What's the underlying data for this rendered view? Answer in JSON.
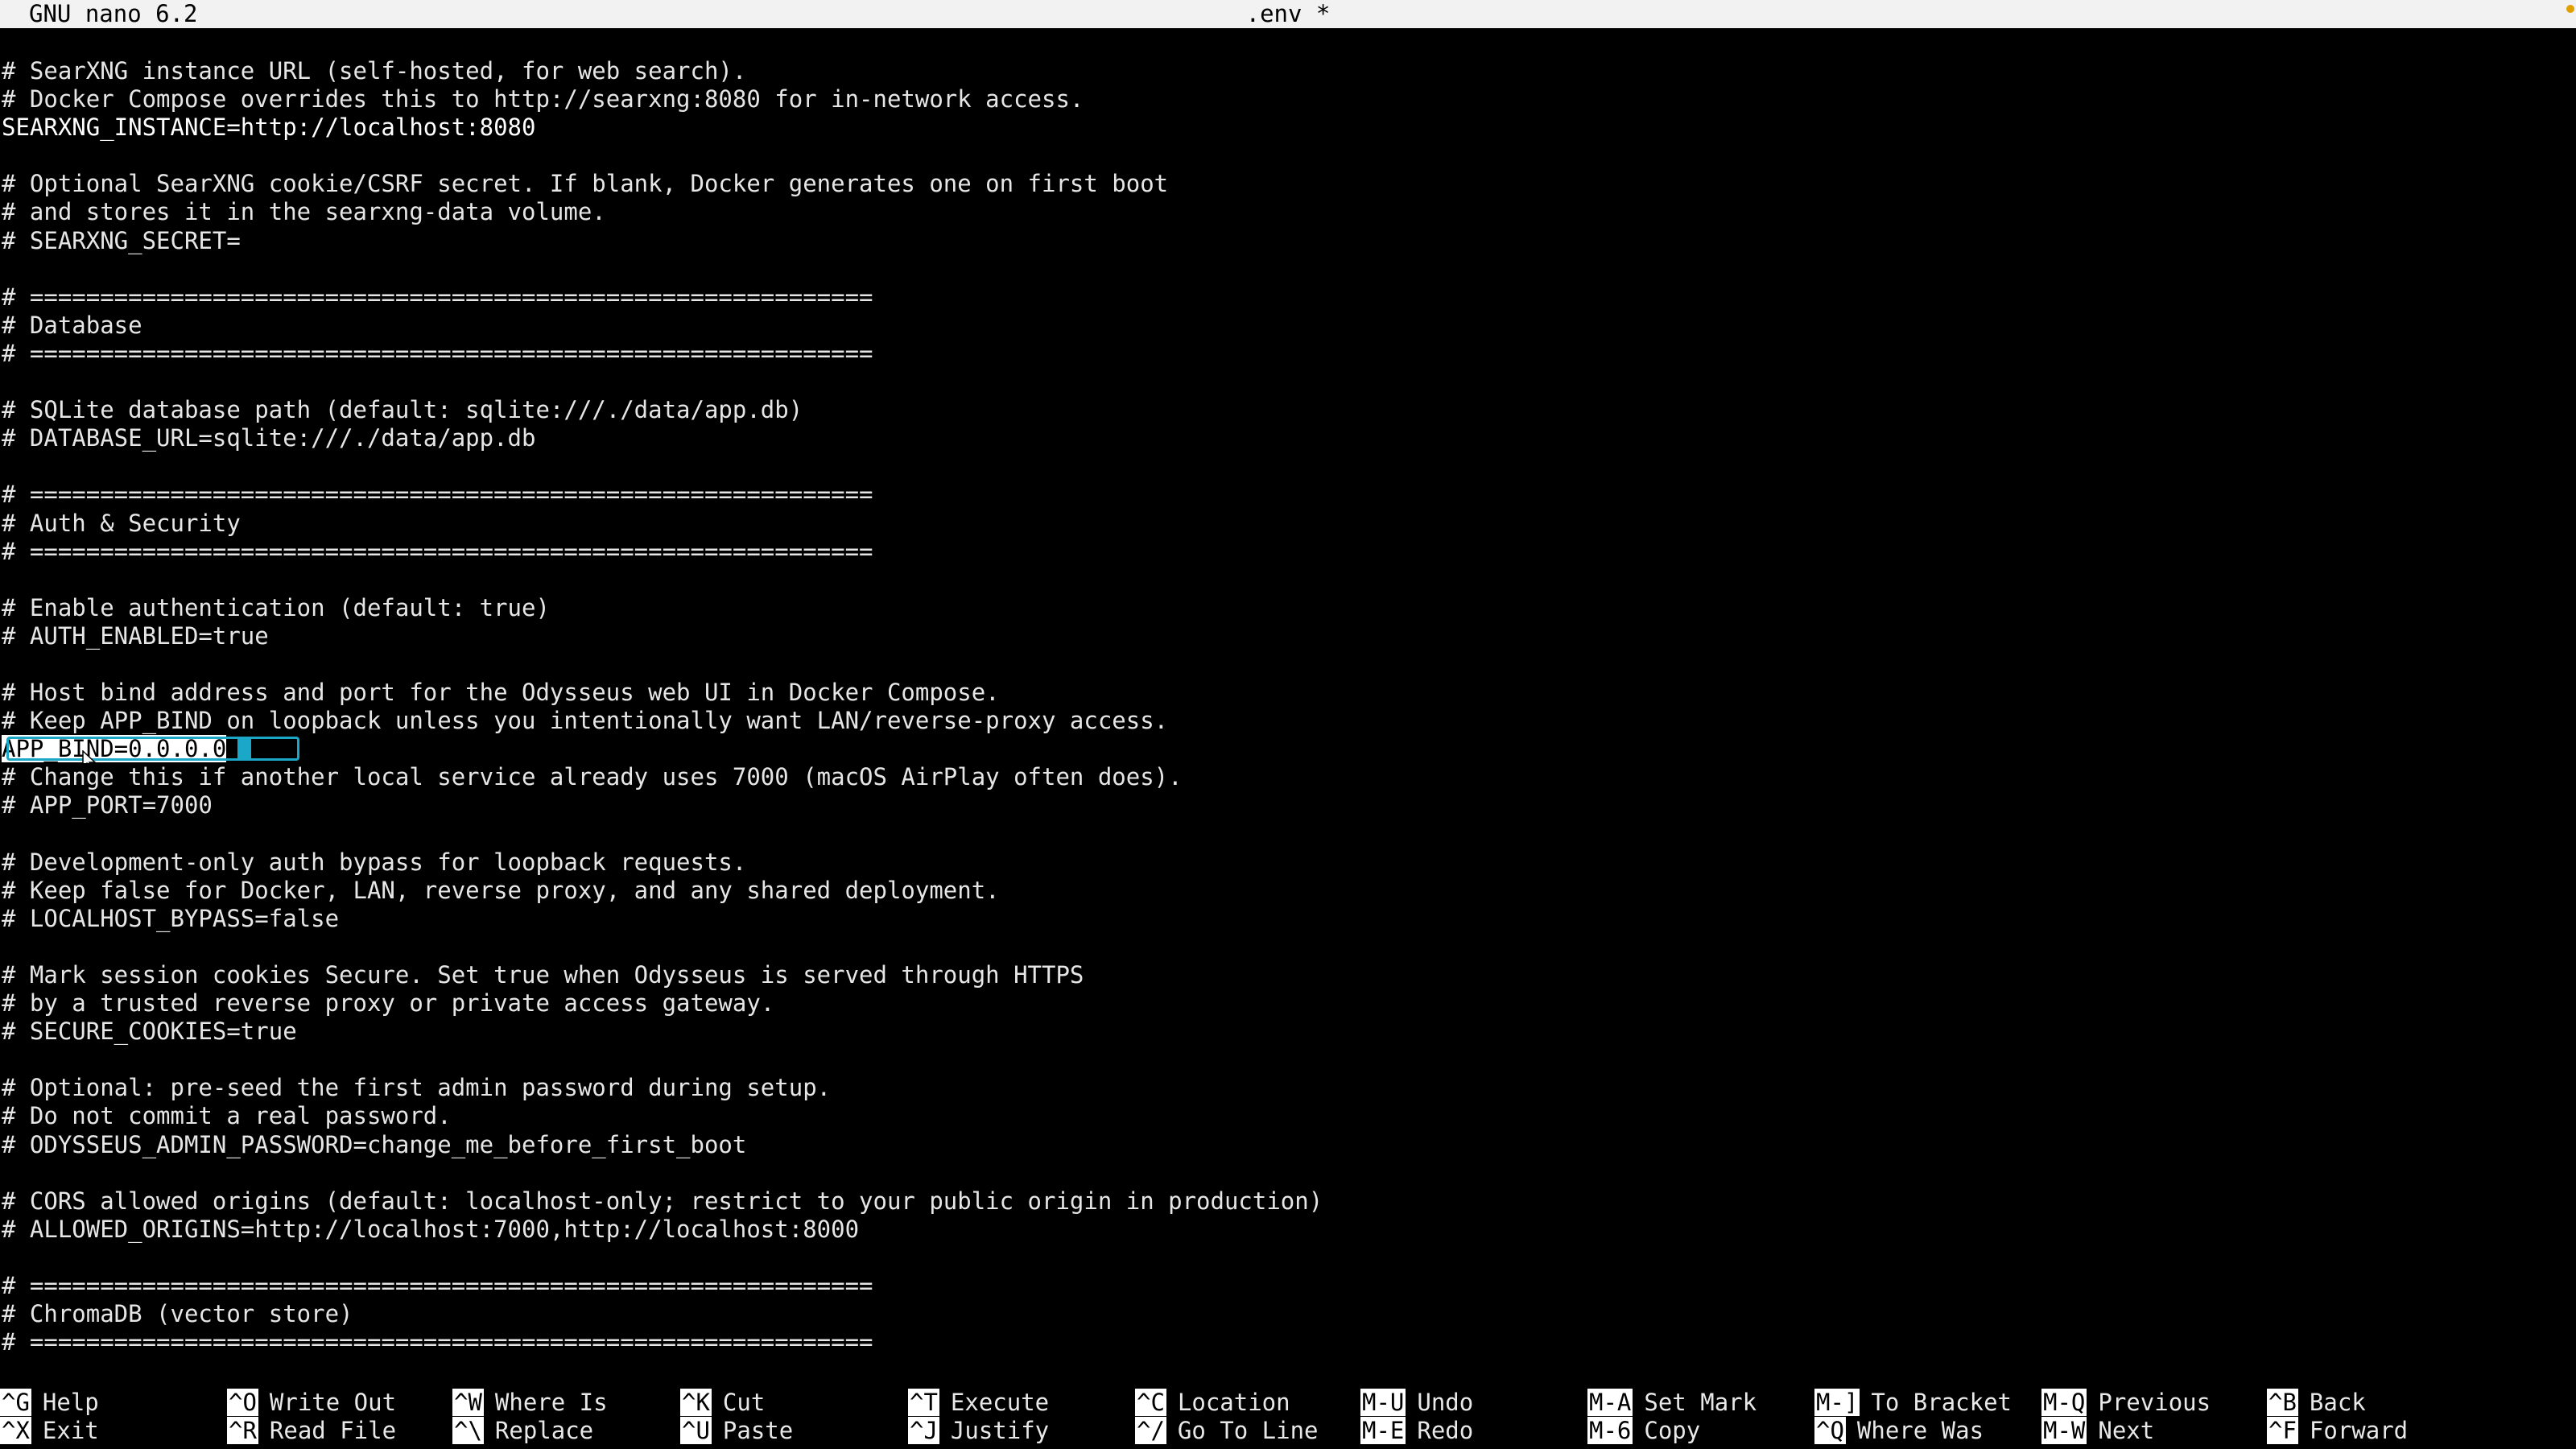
{
  "titlebar": {
    "app": "GNU nano 6.2",
    "file": ".env *"
  },
  "editor": {
    "lines": [
      "# SearXNG instance URL (self-hosted, for web search).",
      "# Docker Compose overrides this to http://searxng:8080 for in-network access.",
      "SEARXNG_INSTANCE=http://localhost:8080",
      "",
      "# Optional SearXNG cookie/CSRF secret. If blank, Docker generates one on first boot",
      "# and stores it in the searxng-data volume.",
      "# SEARXNG_SECRET=",
      "",
      "# ============================================================",
      "# Database",
      "# ============================================================",
      "",
      "# SQLite database path (default: sqlite:///./data/app.db)",
      "# DATABASE_URL=sqlite:///./data/app.db",
      "",
      "# ============================================================",
      "# Auth & Security",
      "# ============================================================",
      "",
      "# Enable authentication (default: true)",
      "# AUTH_ENABLED=true",
      "",
      "# Host bind address and port for the Odysseus web UI in Docker Compose.",
      "# Keep APP_BIND on loopback unless you intentionally want LAN/reverse-proxy access.",
      "APP_BIND=0.0.0.0",
      "# Change this if another local service already uses 7000 (macOS AirPlay often does).",
      "# APP_PORT=7000",
      "",
      "# Development-only auth bypass for loopback requests.",
      "# Keep false for Docker, LAN, reverse proxy, and any shared deployment.",
      "# LOCALHOST_BYPASS=false",
      "",
      "# Mark session cookies Secure. Set true when Odysseus is served through HTTPS",
      "# by a trusted reverse proxy or private access gateway.",
      "# SECURE_COOKIES=true",
      "",
      "# Optional: pre-seed the first admin password during setup.",
      "# Do not commit a real password.",
      "# ODYSSEUS_ADMIN_PASSWORD=change_me_before_first_boot",
      "",
      "# CORS allowed origins (default: localhost-only; restrict to your public origin in production)",
      "# ALLOWED_ORIGINS=http://localhost:7000,http://localhost:8000",
      "",
      "# ============================================================",
      "# ChromaDB (vector store)",
      "# ============================================================"
    ],
    "current_line_index": 24
  },
  "shortcuts": [
    {
      "key": "^G",
      "label": "Help"
    },
    {
      "key": "^X",
      "label": "Exit"
    },
    {
      "key": "^O",
      "label": "Write Out"
    },
    {
      "key": "^R",
      "label": "Read File"
    },
    {
      "key": "^W",
      "label": "Where Is"
    },
    {
      "key": "^\\",
      "label": "Replace"
    },
    {
      "key": "^K",
      "label": "Cut"
    },
    {
      "key": "^U",
      "label": "Paste"
    },
    {
      "key": "^T",
      "label": "Execute"
    },
    {
      "key": "^J",
      "label": "Justify"
    },
    {
      "key": "^C",
      "label": "Location"
    },
    {
      "key": "^/",
      "label": "Go To Line"
    },
    {
      "key": "M-U",
      "label": "Undo"
    },
    {
      "key": "M-E",
      "label": "Redo"
    },
    {
      "key": "M-A",
      "label": "Set Mark"
    },
    {
      "key": "M-6",
      "label": "Copy"
    },
    {
      "key": "M-]",
      "label": "To Bracket"
    },
    {
      "key": "^Q",
      "label": "Where Was"
    },
    {
      "key": "M-Q",
      "label": "Previous"
    },
    {
      "key": "M-W",
      "label": "Next"
    },
    {
      "key": "^B",
      "label": "Back"
    },
    {
      "key": "^F",
      "label": "Forward"
    }
  ]
}
